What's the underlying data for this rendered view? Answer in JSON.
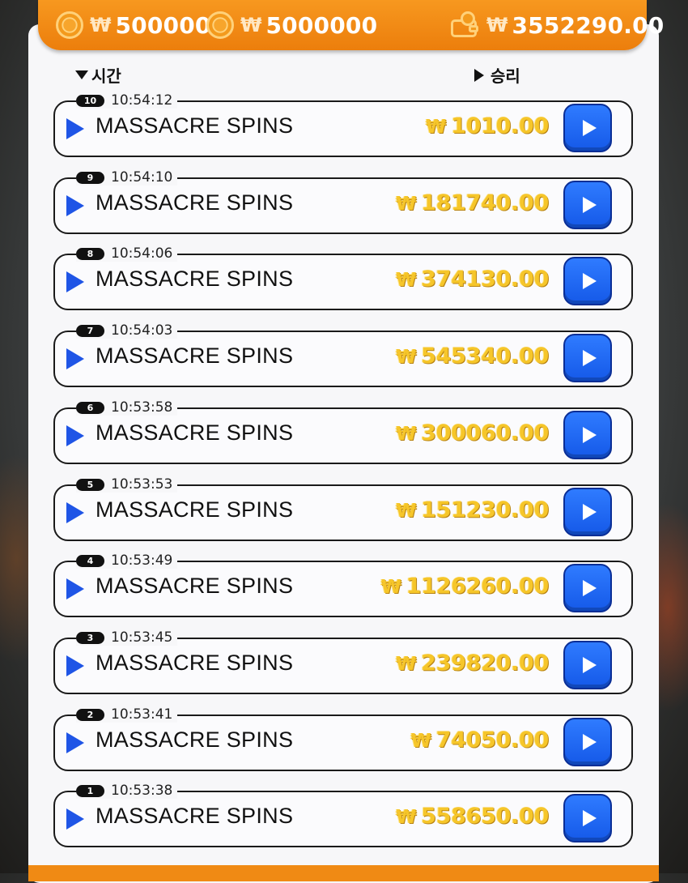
{
  "topbar": {
    "currency_symbol": "₩",
    "balance_1": "500000",
    "balance_2": "5000000",
    "wallet_total": "3552290.00",
    "icons": [
      "coin-icon",
      "coin-icon",
      "wallet-icon"
    ],
    "accent_color": "#f08a14"
  },
  "columns": {
    "time_label": "시간",
    "win_label": "승리"
  },
  "rows": [
    {
      "number": "10",
      "time": "10:54:12",
      "game": "MASSACRE SPINS",
      "currency": "₩",
      "amount": "1010.00"
    },
    {
      "number": "9",
      "time": "10:54:10",
      "game": "MASSACRE SPINS",
      "currency": "₩",
      "amount": "181740.00"
    },
    {
      "number": "8",
      "time": "10:54:06",
      "game": "MASSACRE SPINS",
      "currency": "₩",
      "amount": "374130.00"
    },
    {
      "number": "7",
      "time": "10:54:03",
      "game": "MASSACRE SPINS",
      "currency": "₩",
      "amount": "545340.00"
    },
    {
      "number": "6",
      "time": "10:53:58",
      "game": "MASSACRE SPINS",
      "currency": "₩",
      "amount": "300060.00"
    },
    {
      "number": "5",
      "time": "10:53:53",
      "game": "MASSACRE SPINS",
      "currency": "₩",
      "amount": "151230.00"
    },
    {
      "number": "4",
      "time": "10:53:49",
      "game": "MASSACRE SPINS",
      "currency": "₩",
      "amount": "1126260.00"
    },
    {
      "number": "3",
      "time": "10:53:45",
      "game": "MASSACRE SPINS",
      "currency": "₩",
      "amount": "239820.00"
    },
    {
      "number": "2",
      "time": "10:53:41",
      "game": "MASSACRE SPINS",
      "currency": "₩",
      "amount": "74050.00"
    },
    {
      "number": "1",
      "time": "10:53:38",
      "game": "MASSACRE SPINS",
      "currency": "₩",
      "amount": "558650.00"
    }
  ]
}
